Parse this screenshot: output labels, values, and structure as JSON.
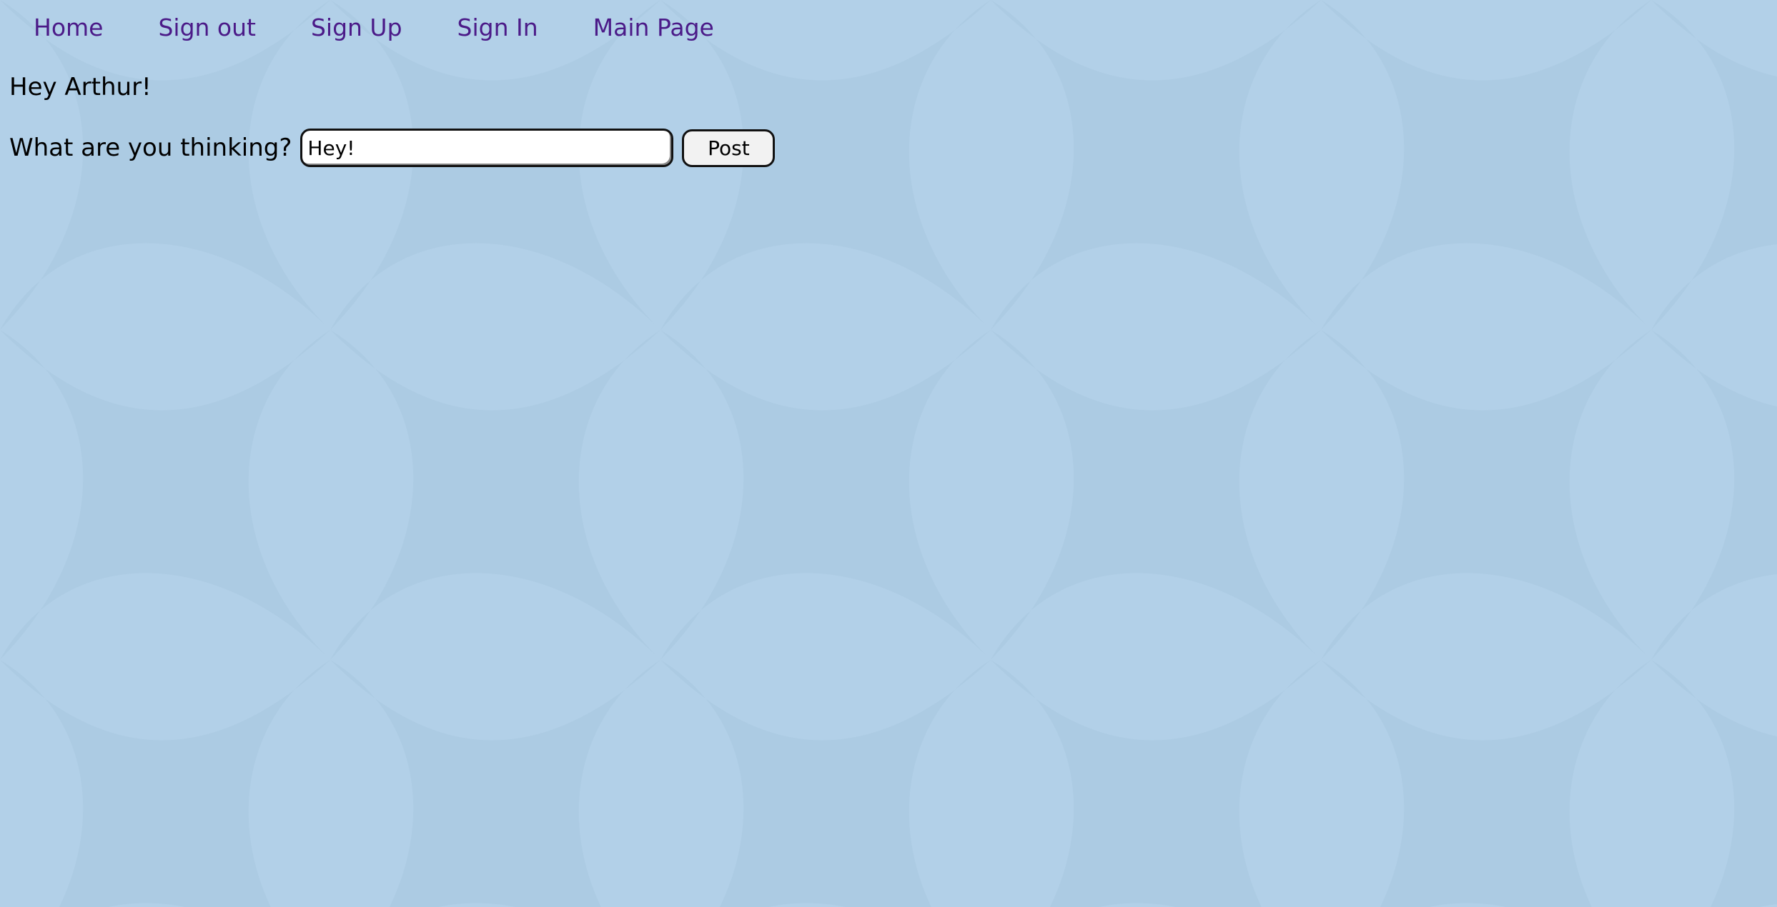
{
  "nav": {
    "items": [
      {
        "label": "Home"
      },
      {
        "label": "Sign out"
      },
      {
        "label": "Sign Up"
      },
      {
        "label": "Sign In"
      },
      {
        "label": "Main Page"
      }
    ]
  },
  "greeting": "Hey Arthur!",
  "post_form": {
    "label": "What are you thinking?",
    "input_value": "Hey!",
    "button_label": "Post"
  },
  "colors": {
    "background": "#b2d0e8",
    "link": "#4b1a88",
    "pattern_shade": "#a6c7dc"
  }
}
